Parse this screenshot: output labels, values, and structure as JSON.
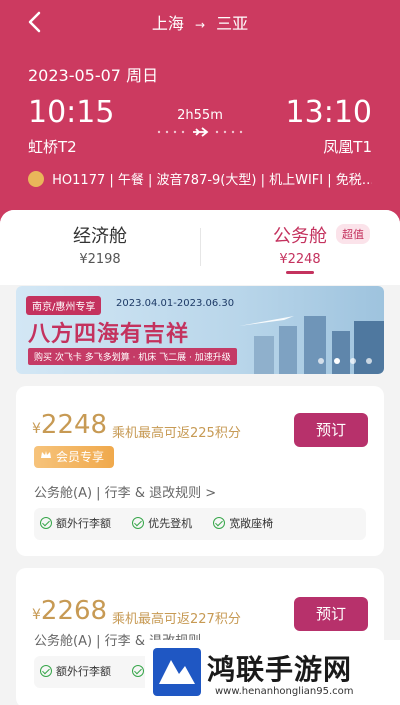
{
  "header": {
    "origin": "上海",
    "destination": "三亚",
    "date": "2023-05-07 周日",
    "depart_time": "10:15",
    "arrive_time": "13:10",
    "duration": "2h55m",
    "depart_airport": "虹桥T2",
    "arrive_airport": "凤凰T1",
    "flight_info": "HO1177 | 午餐 | 波音787-9(大型) | 机上WIFI | 免税…"
  },
  "tabs": [
    {
      "name": "经济舱",
      "price": "¥2198"
    },
    {
      "name": "公务舱",
      "price": "¥2248",
      "badge": "超值"
    }
  ],
  "banner": {
    "tag": "南京/惠州专享",
    "date_range": "2023.04.01-2023.06.30",
    "slogan": "八方四海有吉祥",
    "subline": "购买 次飞卡 多飞多划算 · 机床 飞二展 · 加速升级"
  },
  "fares": [
    {
      "yen": "¥",
      "price": "2248",
      "points": "乘机最高可返225积分",
      "book_label": "预订",
      "member_label": "会员专享",
      "rules": "公务舱(A) | 行李 & 退改规则 >",
      "perks": [
        "额外行李额",
        "优先登机",
        "宽敞座椅"
      ]
    },
    {
      "yen": "¥",
      "price": "2268",
      "points": "乘机最高可返227积分",
      "book_label": "预订",
      "rules": "公务舱(A) | 行李 & 退改规则",
      "perks": [
        "额外行李额",
        "优"
      ]
    }
  ],
  "watermark": {
    "title": "鸿联手游网",
    "url": "www.henanhonglian95.com"
  },
  "colors": {
    "header_bg": "#cc3a60",
    "accent": "#c4325e",
    "gold": "#c79a54",
    "button": "#b7316b"
  }
}
